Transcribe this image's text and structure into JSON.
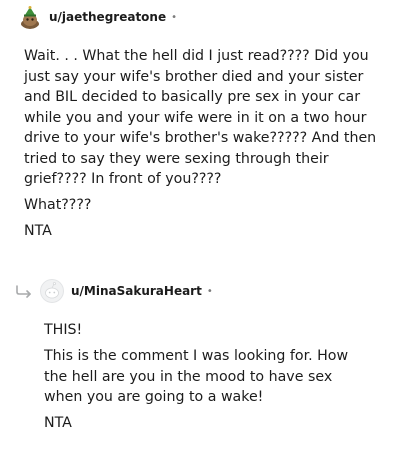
{
  "comments": [
    {
      "username": "u/jaethegreatone",
      "separator": "•",
      "paragraphs": [
        "Wait. . . What the hell did I just read???? Did you just say your wife's brother died and your sister and BIL decided to basically pre sex in your car while you and your wife were in it on a two hour drive to your wife's brother's wake????? And then tried to say they were sexing through their grief???? In front of you????",
        "What????",
        "NTA"
      ]
    },
    {
      "username": "u/MinaSakuraHeart",
      "separator": "•",
      "paragraphs": [
        "THIS!",
        "This is the comment I was looking for. How the hell are you in the mood to have sex when you are going to a wake!",
        "NTA"
      ]
    }
  ],
  "icons": {
    "avatar_1": "snoo-avatar-icon",
    "avatar_2": "default-avatar-icon",
    "reply": "reply-arrow-icon"
  },
  "colors": {
    "text": "#1c1c1c",
    "meta": "#7c7c7c",
    "reply_line": "#a8aaab"
  }
}
